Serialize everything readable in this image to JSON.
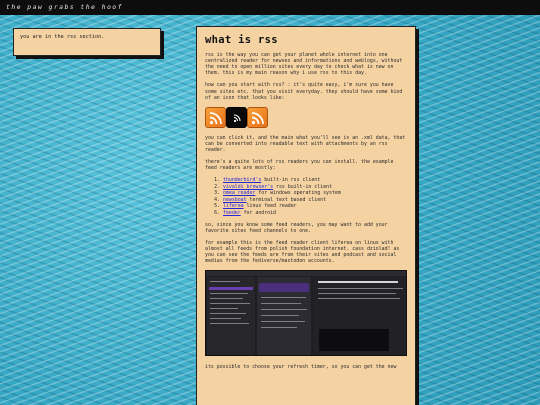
{
  "site": {
    "title": "the paw grabs the hoof"
  },
  "sidebar": {
    "text": "you are in the rss section."
  },
  "article": {
    "heading": "what is rss",
    "intro": "rss is the way you can get your planet whole internet into one centralized reader for newses and informations and weblogs, without the need to open million sites every day to check what is new on them. this is my main reason why i use rss to this day.",
    "how": "how can you start with rss? : it's quite easy, i'm sure you have some sites etc. that you visit everyday. they should have some kind of an icon that looks like:",
    "icons": [
      "rss-feed-icon",
      "rss-feed-icon",
      "rss-feed-icon"
    ],
    "click": "you can click it, and the main what you'll see is an .xml data, that can be converted into readable text with attachments by an rss reader.",
    "readers_intro": "there's a quite lots of rss readers you can install. the example feed readers are mostly:",
    "readers": [
      {
        "name": "thunderbird's",
        "desc": " built-in rss client"
      },
      {
        "name": "vivaldi browser's",
        "desc": " rss built-in client"
      },
      {
        "name": "omea reader",
        "desc": " for windows operating system"
      },
      {
        "name": "newsboat",
        "desc": " terminal text based client"
      },
      {
        "name": "liferea",
        "desc": " linux feed reader"
      },
      {
        "name": "feeder",
        "desc": " for android"
      }
    ],
    "since": "so, since you know some feed readers, you may want to add your favorite sites feed channels to one.",
    "example": "for example this is the feed reader client liferea on linux with almost all feeds from polish foundation internet. cass dziolad! as you can see the feeds are from their sites and podcast and social medias from the fediverse/mastodon accounts.",
    "outro": "its possible to choose your refresh timer, so you can get the new"
  }
}
